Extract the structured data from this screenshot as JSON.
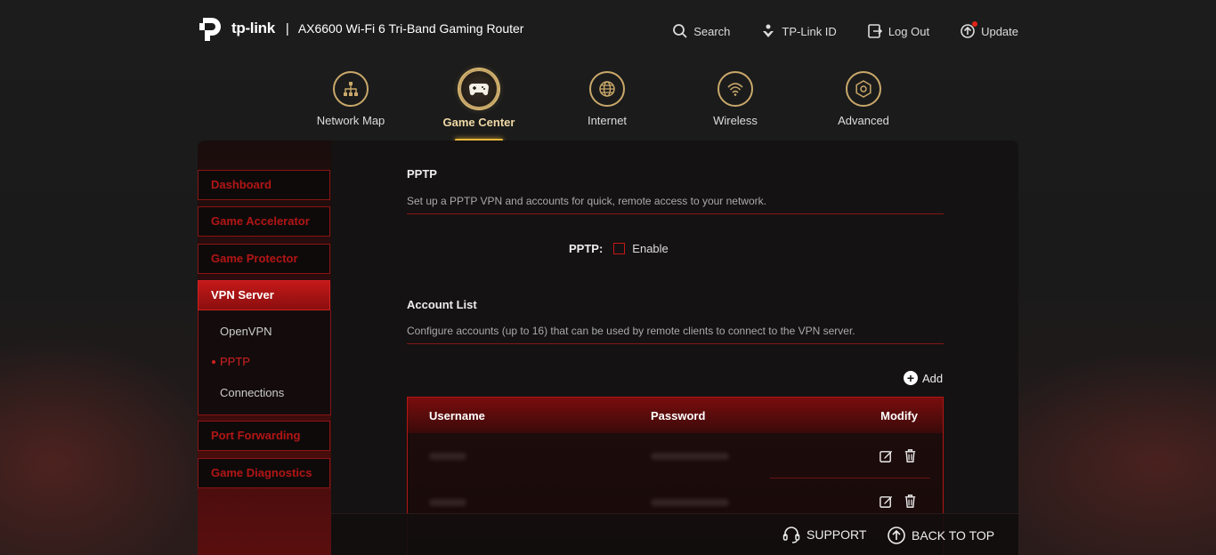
{
  "header": {
    "brand": "tp-link",
    "separator": "|",
    "model": "AX6600 Wi-Fi 6 Tri-Band Gaming Router",
    "actions": {
      "search": "Search",
      "tplink_id": "TP-Link ID",
      "logout": "Log Out",
      "update": "Update"
    }
  },
  "mainnav": {
    "network_map": "Network Map",
    "game_center": "Game Center",
    "internet": "Internet",
    "wireless": "Wireless",
    "advanced": "Advanced",
    "active": "Game Center"
  },
  "sidebar": {
    "dashboard": "Dashboard",
    "game_accelerator": "Game Accelerator",
    "game_protector": "Game Protector",
    "vpn_server": "VPN Server",
    "sub": {
      "openvpn": "OpenVPN",
      "pptp": "PPTP",
      "connections": "Connections"
    },
    "port_forwarding": "Port Forwarding",
    "game_diagnostics": "Game Diagnostics"
  },
  "pptp_section": {
    "title": "PPTP",
    "description": "Set up a PPTP VPN and accounts for quick, remote access to your network.",
    "toggle_label": "PPTP:",
    "enable_label": "Enable",
    "enabled": false
  },
  "account_section": {
    "title": "Account List",
    "description": "Configure accounts (up to 16) that can be used by remote clients to connect to the VPN server.",
    "add_label": "Add",
    "columns": {
      "username": "Username",
      "password": "Password",
      "modify": "Modify"
    }
  },
  "footer": {
    "support": "SUPPORT",
    "back_to_top": "BACK TO TOP"
  },
  "colors": {
    "accent_red": "#c41818",
    "gold": "#d4b46e",
    "underline": "#e8b83a"
  }
}
